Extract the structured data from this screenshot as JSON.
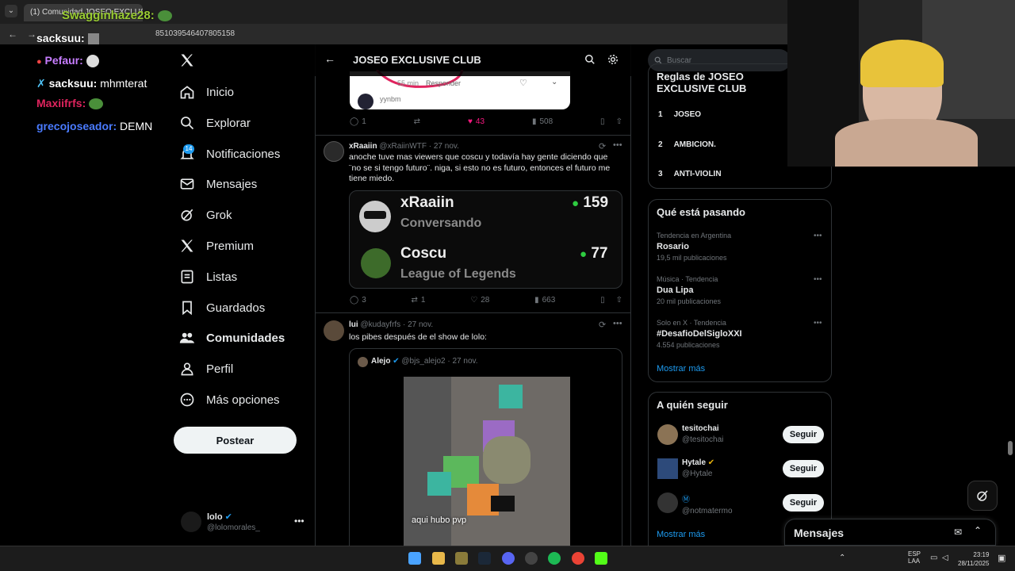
{
  "browser": {
    "tab_title": "(1) Comunidad JOSEO EXCLUS",
    "url": "x.com/i/...8510395464078051​58",
    "url_display": "851039546407805158"
  },
  "chat": [
    {
      "user": "Swagginhaze28:",
      "msg": "",
      "color": "#9acd32"
    },
    {
      "user": "sacksuu:",
      "msg": "",
      "color": "#ffffff"
    },
    {
      "user": "Pefaur:",
      "msg": "",
      "color": "#c77dff"
    },
    {
      "user": "sacksuu:",
      "msg": "mhmterat",
      "color": "#ffffff"
    },
    {
      "user": "Maxiifrfs:",
      "msg": "",
      "color": "#e0245e"
    },
    {
      "user": "grecojoseador:",
      "msg": "DEMN",
      "color": "#4a7bff"
    }
  ],
  "nav": {
    "items": [
      {
        "label": "Inicio",
        "icon": "home-icon"
      },
      {
        "label": "Explorar",
        "icon": "search-icon"
      },
      {
        "label": "Notificaciones",
        "icon": "bell-icon",
        "badge": "14"
      },
      {
        "label": "Mensajes",
        "icon": "mail-icon"
      },
      {
        "label": "Grok",
        "icon": "grok-icon"
      },
      {
        "label": "Premium",
        "icon": "x-logo-icon"
      },
      {
        "label": "Listas",
        "icon": "list-icon"
      },
      {
        "label": "Guardados",
        "icon": "bookmark-icon"
      },
      {
        "label": "Comunidades",
        "icon": "communities-icon"
      },
      {
        "label": "Perfil",
        "icon": "person-icon"
      },
      {
        "label": "Más opciones",
        "icon": "more-circle-icon"
      }
    ],
    "post_label": "Postear",
    "account_name": "lolo",
    "account_handle": "@lolomorales_"
  },
  "header": {
    "title": "JOSEO EXCLUSIVE CLUB"
  },
  "top_tweet": {
    "reply_label": "Responder",
    "minutes": "55 min",
    "user_hint": "yynbm",
    "replies": "1",
    "likes": "43",
    "views": "508"
  },
  "tweets": [
    {
      "name": "xRaaiin",
      "handle": "@xRaiinWTF",
      "date": "· 27 nov.",
      "text": "anoche tuve mas viewers que coscu y todavía hay gente diciendo que ¨no se si tengo futuro¨. niga, si esto no es futuro, entonces el futuro me tiene miedo.",
      "card": {
        "row1_name": "xRaaiin",
        "row1_status": "Conversando",
        "row1_viewers": "159",
        "row2_name": "Coscu",
        "row2_status": "League of Legends",
        "row2_viewers": "77"
      },
      "replies": "3",
      "reposts": "1",
      "likes": "28",
      "views": "663"
    },
    {
      "name": "lui",
      "handle": "@kudayfrfs",
      "date": "· 27 nov.",
      "text": "los pibes después de el show de lolo:",
      "quote": {
        "name": "Alejo",
        "handle": "@bjs_alejo2",
        "date": "· 27 nov.",
        "image_caption": "aqui hubo pvp"
      }
    }
  ],
  "right": {
    "search_placeholder": "Buscar",
    "rules_title": "Reglas de JOSEO EXCLUSIVE CLUB",
    "rules": [
      {
        "n": "1",
        "text": "JOSEO"
      },
      {
        "n": "2",
        "text": "AMBICION."
      },
      {
        "n": "3",
        "text": "ANTI-VIOLIN"
      }
    ],
    "trends_title": "Qué está pasando",
    "trends": [
      {
        "meta": "Tendencia en Argentina",
        "name": "Rosario",
        "count": "19,5 mil publicaciones"
      },
      {
        "meta": "Música · Tendencia",
        "name": "Dua Lipa",
        "count": "20 mil publicaciones"
      },
      {
        "meta": "Solo en X · Tendencia",
        "name": "#DesafioDelSigloXXI",
        "count": "4.554 publicaciones"
      }
    ],
    "show_more": "Mostrar más",
    "follow_title": "A quién seguir",
    "follow": [
      {
        "name": "tesitochai",
        "handle": "@tesitochai"
      },
      {
        "name": "Hytale",
        "handle": "@Hytale"
      },
      {
        "name": "",
        "handle": "@notmatermo"
      }
    ],
    "follow_label": "Seguir",
    "messages_label": "Mensajes"
  },
  "taskbar": {
    "lang_top": "ESP",
    "lang_bottom": "LAA",
    "time": "23:19",
    "date": "28/11/2025"
  }
}
